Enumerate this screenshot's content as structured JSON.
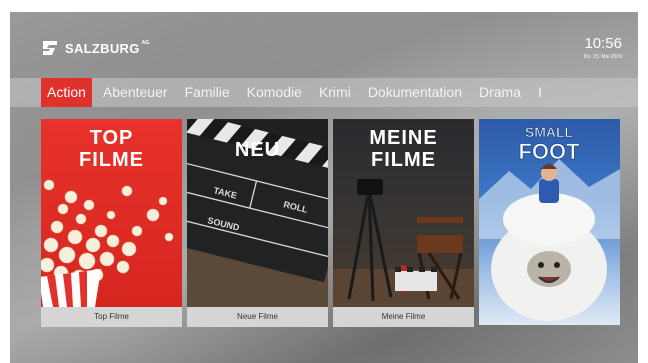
{
  "header": {
    "logo_text": "SALZBURG",
    "logo_sup": "AG",
    "time": "10:56",
    "date": "Do. 23. Mai 2019"
  },
  "nav": {
    "items": [
      {
        "label": "Action",
        "active": true
      },
      {
        "label": "Abenteuer"
      },
      {
        "label": "Familie"
      },
      {
        "label": "Komodie"
      },
      {
        "label": "Krimi"
      },
      {
        "label": "Dokumentation"
      },
      {
        "label": "Drama"
      },
      {
        "label": "I"
      }
    ]
  },
  "tiles": [
    {
      "title_line1": "TOP",
      "title_line2": "FILME",
      "caption": "Top Filme"
    },
    {
      "title_line1": "NEU",
      "clapper_take": "TAKE",
      "clapper_roll": "ROLL",
      "clapper_sound": "SOUND",
      "caption": "Neue Filme"
    },
    {
      "title_line1": "MEINE",
      "title_line2": "FILME",
      "caption": "Meine Filme"
    },
    {
      "poster_title_1": "SMALL",
      "poster_title_2": "FOOT"
    }
  ],
  "colors": {
    "accent": "#e0312d",
    "nav_bg": "#c8c8c8",
    "caption_bg": "#d5d5d5"
  }
}
